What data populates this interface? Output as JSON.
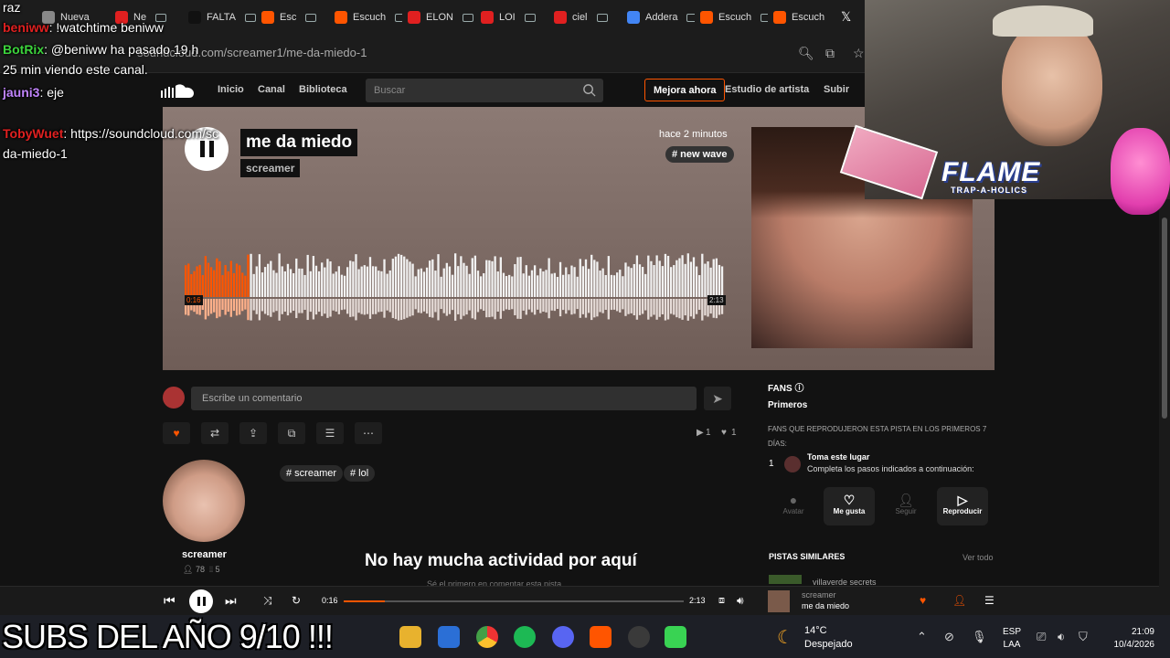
{
  "browser": {
    "tabs": [
      {
        "label": "Nueva",
        "color": "#888888"
      },
      {
        "label": "Ne",
        "color": "#e02020"
      },
      {
        "label": "FALTA",
        "color": "#111111"
      },
      {
        "label": "Esc",
        "color": "#ff5500"
      },
      {
        "label": "Escuch",
        "color": "#ff5500"
      },
      {
        "label": "ELON",
        "color": "#e02020"
      },
      {
        "label": "LOI",
        "color": "#e02020"
      },
      {
        "label": "ciel",
        "color": "#e02020"
      },
      {
        "label": "Addera",
        "color": "#4285f4"
      },
      {
        "label": "Escuch",
        "color": "#ff5500"
      },
      {
        "label": "Escuch",
        "color": "#ff5500"
      }
    ],
    "url": "soundcloud.com/screamer1/me-da-miedo-1"
  },
  "nav": {
    "items": [
      "Inicio",
      "Canal",
      "Biblioteca"
    ],
    "search_placeholder": "Buscar",
    "upgrade": "Mejora ahora",
    "artist_studio": "Estudio de artista",
    "upload": "Subir"
  },
  "track": {
    "title": "me da miedo",
    "artist": "screamer",
    "posted": "hace 2 minutos",
    "genre_tag": "# new wave",
    "current_time": "0:16",
    "duration": "2:13",
    "progress": 0.12,
    "plays": "1",
    "likes": "1"
  },
  "comment": {
    "placeholder": "Escribe un comentario"
  },
  "profile": {
    "name": "screamer",
    "followers": "78",
    "tracks": "5",
    "tags": [
      "# screamer",
      "# lol"
    ]
  },
  "activity": {
    "title": "No hay mucha actividad por aquí",
    "subtitle": "Sé el primero en comentar esta pista"
  },
  "fans": {
    "title": "FANS",
    "tab": "Primeros",
    "description": "FANS QUE REPRODUJERON ESTA PISTA EN LOS PRIMEROS 7 DÍAS:",
    "rank": "1",
    "entry_title": "Toma este lugar",
    "entry_sub": "Completa los pasos indicados a continuación:",
    "steps": [
      {
        "label": "Avatar",
        "icon": "avatar-icon",
        "active": false
      },
      {
        "label": "Me gusta",
        "icon": "heart-icon",
        "active": true
      },
      {
        "label": "Seguir",
        "icon": "user-icon",
        "active": false
      },
      {
        "label": "Reproducir",
        "icon": "play-icon",
        "active": true
      }
    ]
  },
  "similar": {
    "title": "PISTAS SIMILARES",
    "view_all": "Ver todo",
    "first_item": "villaverde secrets"
  },
  "player": {
    "current_time": "0:16",
    "duration": "2:13",
    "progress": 0.12,
    "artist": "screamer",
    "title": "me da miedo"
  },
  "chat": [
    {
      "user": "",
      "text": "raz",
      "user_color": "#ffffff"
    },
    {
      "user": "beniww",
      "text": ": !watchtime beniww",
      "user_color": "#e02020"
    },
    {
      "user": "BotRix",
      "text": ": @beniww ha pasado 19 h",
      "user_color": "#3cd43c"
    },
    {
      "user": "",
      "text": "25 min viendo este canal.",
      "user_color": "#ffffff"
    },
    {
      "user": "jauni3",
      "text": ": eje",
      "user_color": "#c084fc"
    },
    {
      "user": "TobyWuet",
      "text": ": https://soundcloud.com/sc",
      "user_color": "#e02020"
    },
    {
      "user": "",
      "text": "da-miedo-1",
      "user_color": "#ffffff"
    }
  ],
  "overlay": {
    "brand": "FLAME",
    "brand_sub": "TRAP-A-HOLICS",
    "caption": "SUBS DEL AÑO 9/10 !!!"
  },
  "taskbar": {
    "temperature": "14°C",
    "condition": "Despejado",
    "lang": "ESP",
    "lang_sub": "LAA",
    "time": "21:09",
    "date": "10/4/2026"
  },
  "colors": {
    "accent": "#ff5500",
    "background": "#121212"
  }
}
